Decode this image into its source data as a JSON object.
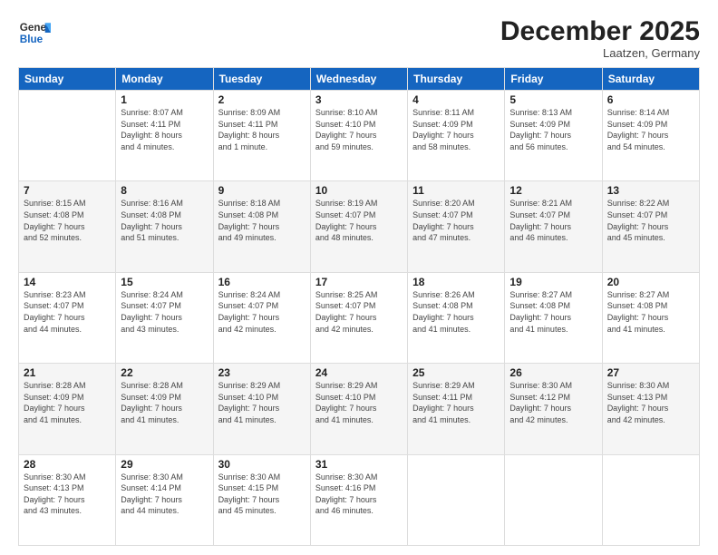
{
  "header": {
    "logo_general": "General",
    "logo_blue": "Blue",
    "month_title": "December 2025",
    "location": "Laatzen, Germany"
  },
  "days_of_week": [
    "Sunday",
    "Monday",
    "Tuesday",
    "Wednesday",
    "Thursday",
    "Friday",
    "Saturday"
  ],
  "weeks": [
    [
      {
        "day": "",
        "info": ""
      },
      {
        "day": "1",
        "info": "Sunrise: 8:07 AM\nSunset: 4:11 PM\nDaylight: 8 hours\nand 4 minutes."
      },
      {
        "day": "2",
        "info": "Sunrise: 8:09 AM\nSunset: 4:11 PM\nDaylight: 8 hours\nand 1 minute."
      },
      {
        "day": "3",
        "info": "Sunrise: 8:10 AM\nSunset: 4:10 PM\nDaylight: 7 hours\nand 59 minutes."
      },
      {
        "day": "4",
        "info": "Sunrise: 8:11 AM\nSunset: 4:09 PM\nDaylight: 7 hours\nand 58 minutes."
      },
      {
        "day": "5",
        "info": "Sunrise: 8:13 AM\nSunset: 4:09 PM\nDaylight: 7 hours\nand 56 minutes."
      },
      {
        "day": "6",
        "info": "Sunrise: 8:14 AM\nSunset: 4:09 PM\nDaylight: 7 hours\nand 54 minutes."
      }
    ],
    [
      {
        "day": "7",
        "info": "Sunrise: 8:15 AM\nSunset: 4:08 PM\nDaylight: 7 hours\nand 52 minutes."
      },
      {
        "day": "8",
        "info": "Sunrise: 8:16 AM\nSunset: 4:08 PM\nDaylight: 7 hours\nand 51 minutes."
      },
      {
        "day": "9",
        "info": "Sunrise: 8:18 AM\nSunset: 4:08 PM\nDaylight: 7 hours\nand 49 minutes."
      },
      {
        "day": "10",
        "info": "Sunrise: 8:19 AM\nSunset: 4:07 PM\nDaylight: 7 hours\nand 48 minutes."
      },
      {
        "day": "11",
        "info": "Sunrise: 8:20 AM\nSunset: 4:07 PM\nDaylight: 7 hours\nand 47 minutes."
      },
      {
        "day": "12",
        "info": "Sunrise: 8:21 AM\nSunset: 4:07 PM\nDaylight: 7 hours\nand 46 minutes."
      },
      {
        "day": "13",
        "info": "Sunrise: 8:22 AM\nSunset: 4:07 PM\nDaylight: 7 hours\nand 45 minutes."
      }
    ],
    [
      {
        "day": "14",
        "info": "Sunrise: 8:23 AM\nSunset: 4:07 PM\nDaylight: 7 hours\nand 44 minutes."
      },
      {
        "day": "15",
        "info": "Sunrise: 8:24 AM\nSunset: 4:07 PM\nDaylight: 7 hours\nand 43 minutes."
      },
      {
        "day": "16",
        "info": "Sunrise: 8:24 AM\nSunset: 4:07 PM\nDaylight: 7 hours\nand 42 minutes."
      },
      {
        "day": "17",
        "info": "Sunrise: 8:25 AM\nSunset: 4:07 PM\nDaylight: 7 hours\nand 42 minutes."
      },
      {
        "day": "18",
        "info": "Sunrise: 8:26 AM\nSunset: 4:08 PM\nDaylight: 7 hours\nand 41 minutes."
      },
      {
        "day": "19",
        "info": "Sunrise: 8:27 AM\nSunset: 4:08 PM\nDaylight: 7 hours\nand 41 minutes."
      },
      {
        "day": "20",
        "info": "Sunrise: 8:27 AM\nSunset: 4:08 PM\nDaylight: 7 hours\nand 41 minutes."
      }
    ],
    [
      {
        "day": "21",
        "info": "Sunrise: 8:28 AM\nSunset: 4:09 PM\nDaylight: 7 hours\nand 41 minutes."
      },
      {
        "day": "22",
        "info": "Sunrise: 8:28 AM\nSunset: 4:09 PM\nDaylight: 7 hours\nand 41 minutes."
      },
      {
        "day": "23",
        "info": "Sunrise: 8:29 AM\nSunset: 4:10 PM\nDaylight: 7 hours\nand 41 minutes."
      },
      {
        "day": "24",
        "info": "Sunrise: 8:29 AM\nSunset: 4:10 PM\nDaylight: 7 hours\nand 41 minutes."
      },
      {
        "day": "25",
        "info": "Sunrise: 8:29 AM\nSunset: 4:11 PM\nDaylight: 7 hours\nand 41 minutes."
      },
      {
        "day": "26",
        "info": "Sunrise: 8:30 AM\nSunset: 4:12 PM\nDaylight: 7 hours\nand 42 minutes."
      },
      {
        "day": "27",
        "info": "Sunrise: 8:30 AM\nSunset: 4:13 PM\nDaylight: 7 hours\nand 42 minutes."
      }
    ],
    [
      {
        "day": "28",
        "info": "Sunrise: 8:30 AM\nSunset: 4:13 PM\nDaylight: 7 hours\nand 43 minutes."
      },
      {
        "day": "29",
        "info": "Sunrise: 8:30 AM\nSunset: 4:14 PM\nDaylight: 7 hours\nand 44 minutes."
      },
      {
        "day": "30",
        "info": "Sunrise: 8:30 AM\nSunset: 4:15 PM\nDaylight: 7 hours\nand 45 minutes."
      },
      {
        "day": "31",
        "info": "Sunrise: 8:30 AM\nSunset: 4:16 PM\nDaylight: 7 hours\nand 46 minutes."
      },
      {
        "day": "",
        "info": ""
      },
      {
        "day": "",
        "info": ""
      },
      {
        "day": "",
        "info": ""
      }
    ]
  ]
}
